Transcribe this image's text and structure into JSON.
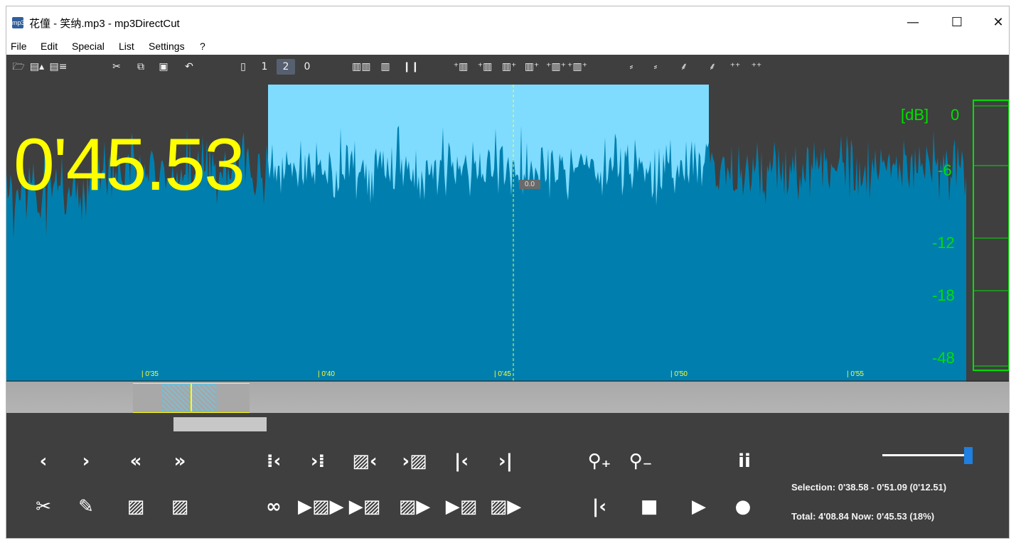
{
  "window": {
    "title": "花僮 - 笑纳.mp3 - mp3DirectCut",
    "icon_text": "mp3",
    "controls": {
      "minimize": "—",
      "maximize": "☐",
      "close": "✕"
    }
  },
  "menu": [
    "File",
    "Edit",
    "Special",
    "List",
    "Settings",
    "?"
  ],
  "toolbar": [
    {
      "name": "open-icon",
      "glyph": "🗁"
    },
    {
      "name": "save-icon",
      "glyph": "▤▴"
    },
    {
      "name": "save-list-icon",
      "glyph": "▤≡"
    },
    {
      "name": "cut-icon",
      "glyph": "✂"
    },
    {
      "name": "copy-icon",
      "glyph": "⧉"
    },
    {
      "name": "paste-icon",
      "glyph": "▣"
    },
    {
      "name": "undo-icon",
      "glyph": "↶"
    },
    {
      "name": "page-icon",
      "glyph": "▯"
    },
    {
      "name": "page-1-icon",
      "glyph": "1"
    },
    {
      "name": "page-2-icon",
      "glyph": "2"
    },
    {
      "name": "page-0-icon",
      "glyph": "0"
    },
    {
      "name": "split-many-icon",
      "glyph": "▥▥"
    },
    {
      "name": "split-icon",
      "glyph": "▥"
    },
    {
      "name": "pause-marker-icon",
      "glyph": "❙❙"
    },
    {
      "name": "marker-1-icon",
      "glyph": "⁺▥"
    },
    {
      "name": "marker-2-icon",
      "glyph": "⁺▥"
    },
    {
      "name": "marker-3-icon",
      "glyph": "▥⁺"
    },
    {
      "name": "marker-4-icon",
      "glyph": "▥⁺"
    },
    {
      "name": "marker-5-icon",
      "glyph": "⁺▥⁺"
    },
    {
      "name": "marker-6-icon",
      "glyph": "⁺▥⁺"
    },
    {
      "name": "fade-1-icon",
      "glyph": "⸗"
    },
    {
      "name": "fade-2-icon",
      "glyph": "⸗"
    },
    {
      "name": "fade-3-icon",
      "glyph": "⸙"
    },
    {
      "name": "fade-4-icon",
      "glyph": "⸙"
    },
    {
      "name": "fade-5-icon",
      "glyph": "⁺⁺"
    },
    {
      "name": "fade-6-icon",
      "glyph": "⁺⁺"
    }
  ],
  "editor": {
    "current_time": "0'45.53",
    "cursor_value": "0.0",
    "db_header": "[dB]",
    "db_scale": [
      "0",
      "-6",
      "-12",
      "-18",
      "-48"
    ],
    "time_ticks": [
      "| 0'35",
      "| 0'40",
      "| 0'45",
      "| 0'50",
      "| 0'55"
    ]
  },
  "transport": {
    "row1": [
      {
        "name": "prev-frame-button",
        "glyph": "‹"
      },
      {
        "name": "next-frame-button",
        "glyph": "›"
      },
      {
        "name": "rewind-button",
        "glyph": "«"
      },
      {
        "name": "fast-forward-button",
        "glyph": "»"
      },
      {
        "name": "to-prev-marker-button",
        "glyph": "⁞‹"
      },
      {
        "name": "to-next-marker-button",
        "glyph": "›⁞"
      },
      {
        "name": "sel-start-left-button",
        "glyph": "▨‹"
      },
      {
        "name": "sel-end-right-button",
        "glyph": "›▨"
      },
      {
        "name": "go-start-button",
        "glyph": "|‹"
      },
      {
        "name": "go-end-button",
        "glyph": "›|"
      },
      {
        "name": "zoom-in-button",
        "glyph": "⚲₊"
      },
      {
        "name": "zoom-out-button",
        "glyph": "⚲₋"
      },
      {
        "name": "info-button",
        "glyph": "ii"
      }
    ],
    "row2": [
      {
        "name": "cut-button",
        "glyph": "✂"
      },
      {
        "name": "edit-button",
        "glyph": "✎"
      },
      {
        "name": "selection-pattern-button",
        "glyph": "▨"
      },
      {
        "name": "selection-pattern-2-button",
        "glyph": "▨"
      },
      {
        "name": "loop-button",
        "glyph": "∞"
      },
      {
        "name": "play-selection-button",
        "glyph": "▶▨▶"
      },
      {
        "name": "play-to-selection-button",
        "glyph": "▶▨"
      },
      {
        "name": "play-from-selection-button",
        "glyph": "▨▶"
      },
      {
        "name": "play-sel-end-button",
        "glyph": "▶▨"
      },
      {
        "name": "play-after-selection-button",
        "glyph": "▨▶"
      },
      {
        "name": "go-start-2-button",
        "glyph": "|‹"
      },
      {
        "name": "stop-button",
        "glyph": "■"
      },
      {
        "name": "play-button",
        "glyph": "▶"
      },
      {
        "name": "record-button",
        "glyph": "●"
      }
    ]
  },
  "status": {
    "selection": "Selection: 0'38.58 - 0'51.09 (0'12.51)",
    "total": "Total: 4'08.84  Now: 0'45.53  (18%)"
  },
  "volume_level": 0.99,
  "colors": {
    "wave": "#007fae",
    "wave_highlight": "#7fdcff",
    "time_text": "#ffff00",
    "db_text": "#00e000",
    "background": "#3f3f3f"
  }
}
